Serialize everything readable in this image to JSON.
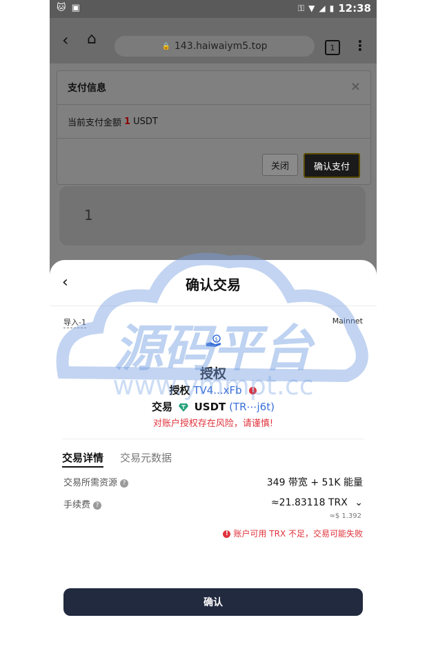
{
  "status_bar": {
    "time": "12:38"
  },
  "browser": {
    "url": "143.haiwaiym5.top",
    "tab_count": "1"
  },
  "dialog": {
    "title": "支付信息",
    "close_symbol": "×",
    "amount_label": "当前支付金额",
    "amount_value": "1",
    "amount_unit": "USDT",
    "close_button": "关闭",
    "confirm_button": "确认支付"
  },
  "amount_box": {
    "value": "1"
  },
  "watermark": {
    "title": "源码平台",
    "url": "www.ymmpt.cc"
  },
  "sheet": {
    "title": "确认交易",
    "account": "导入-1",
    "network": "Mainnet",
    "section_title": "授权",
    "approve_label": "授权",
    "approve_address": "TV4...xFb",
    "trade_label": "交易",
    "token": "USDT",
    "token_address": "(TR⋯j6t)",
    "risk_warning": "对账户授权存在风险，请谨慎!",
    "tabs": [
      "交易详情",
      "交易元数据"
    ],
    "resources_label": "交易所需资源",
    "resources_value": "349 带宽 + 51K 能量",
    "fee_label": "手续费",
    "fee_value": "≈21.83118 TRX",
    "fee_usd": "≈$ 1.392",
    "insufficient_warning": "账户可用 TRX 不足，交易可能失败",
    "confirm_button": "确认"
  },
  "colors": {
    "accent_blue": "#3a6fd8",
    "danger": "#e0333c",
    "confirm_bg": "#212a3f"
  }
}
